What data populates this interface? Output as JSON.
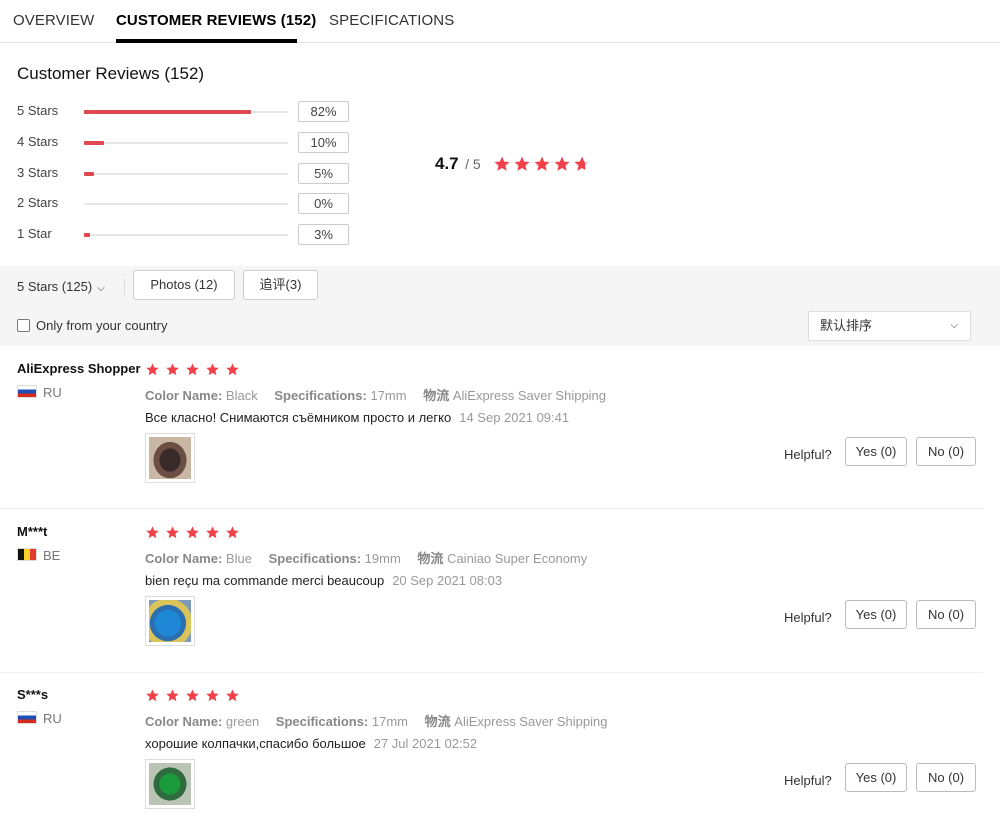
{
  "tabs": [
    {
      "label": "OVERVIEW"
    },
    {
      "label": "CUSTOMER REVIEWS (152)"
    },
    {
      "label": "SPECIFICATIONS"
    }
  ],
  "summary": {
    "title": "Customer Reviews (152)",
    "distribution": [
      {
        "label": "5 Stars",
        "percent": "82%",
        "value": 82
      },
      {
        "label": "4 Stars",
        "percent": "10%",
        "value": 10
      },
      {
        "label": "3 Stars",
        "percent": "5%",
        "value": 5
      },
      {
        "label": "2 Stars",
        "percent": "0%",
        "value": 0
      },
      {
        "label": "1 Star",
        "percent": "3%",
        "value": 3
      }
    ],
    "average": "4.7",
    "average_max": "/ 5",
    "average_value": 4.7
  },
  "filters": {
    "star_filter": "5 Stars (125)",
    "photos_label": "Photos (12)",
    "followup_label": "追评(3)",
    "country_label": "Only from your country",
    "sort_label": "默认排序"
  },
  "reviews": [
    {
      "name": "AliExpress Shopper",
      "country": "RU",
      "rating": 5,
      "color_key": "Color Name:",
      "color_value": "Black",
      "spec_key": "Specifications:",
      "spec_value": "17mm",
      "ship_key": "物流",
      "ship_value": "AliExpress Saver Shipping",
      "text": "Все класно! Снимаются съёмником просто и легко",
      "date": "14 Sep 2021 09:41",
      "helpful_label": "Helpful?",
      "yes_label": "Yes (0)",
      "no_label": "No (0)"
    },
    {
      "name": "M***t",
      "country": "BE",
      "rating": 5,
      "color_key": "Color Name:",
      "color_value": "Blue",
      "spec_key": "Specifications:",
      "spec_value": "19mm",
      "ship_key": "物流",
      "ship_value": "Cainiao Super Economy",
      "text": "bien reçu ma commande merci beaucoup",
      "date": "20 Sep 2021 08:03",
      "helpful_label": "Helpful?",
      "yes_label": "Yes (0)",
      "no_label": "No (0)"
    },
    {
      "name": "S***s",
      "country": "RU",
      "rating": 5,
      "color_key": "Color Name:",
      "color_value": "green",
      "spec_key": "Specifications:",
      "spec_value": "17mm",
      "ship_key": "物流",
      "ship_value": "AliExpress Saver Shipping",
      "text": "хорошие колпачки,спасибо большое",
      "date": "27 Jul 2021 02:52",
      "helpful_label": "Helpful?",
      "yes_label": "Yes (0)",
      "no_label": "No (0)"
    }
  ],
  "colors": {
    "accent": "#e0474f",
    "star": "#f0414b"
  }
}
